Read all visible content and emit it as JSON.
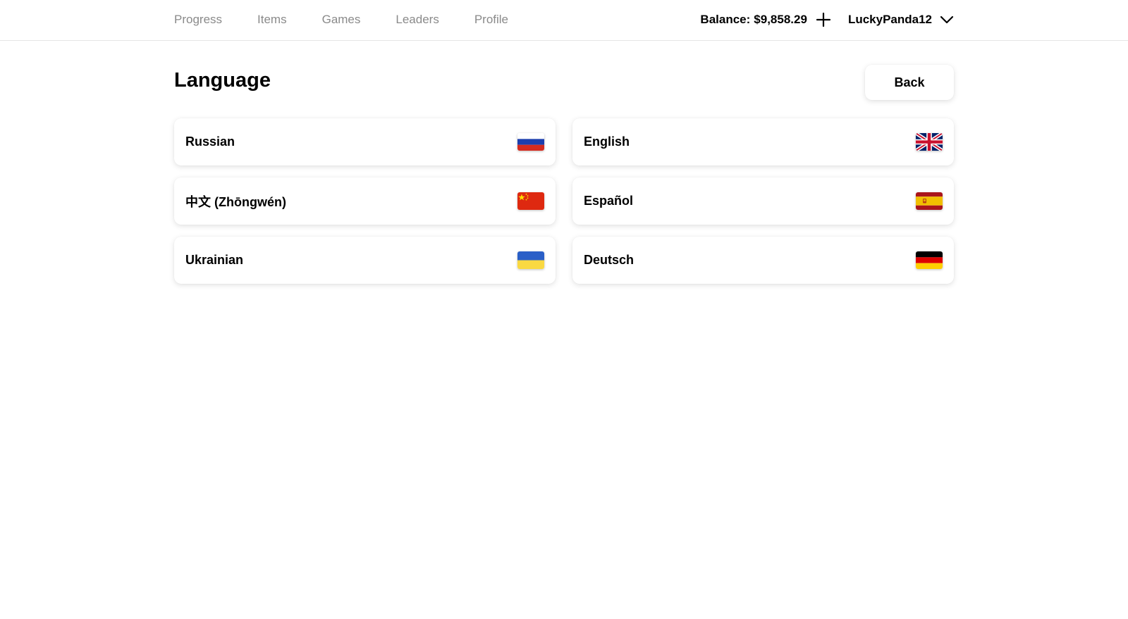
{
  "nav": {
    "items": [
      {
        "label": "Progress"
      },
      {
        "label": "Items"
      },
      {
        "label": "Games"
      },
      {
        "label": "Leaders"
      },
      {
        "label": "Profile"
      }
    ]
  },
  "account": {
    "balance_label": "Balance:",
    "balance_value": "$9,858.29",
    "add_icon": "plus-icon",
    "username": "LuckyPanda12",
    "menu_icon": "chevron-down-icon"
  },
  "page": {
    "title": "Language",
    "back_label": "Back"
  },
  "languages": [
    {
      "label": "Russian",
      "flag": "russia-flag-icon"
    },
    {
      "label": "English",
      "flag": "uk-flag-icon"
    },
    {
      "label": "中文 (Zhōngwén)",
      "flag": "china-flag-icon"
    },
    {
      "label": "Español",
      "flag": "spain-flag-icon"
    },
    {
      "label": "Ukrainian",
      "flag": "ukraine-flag-icon"
    },
    {
      "label": "Deutsch",
      "flag": "germany-flag-icon"
    }
  ],
  "colors": {
    "nav_text": "#8a8a8a",
    "text": "#000000",
    "background": "#ffffff"
  }
}
